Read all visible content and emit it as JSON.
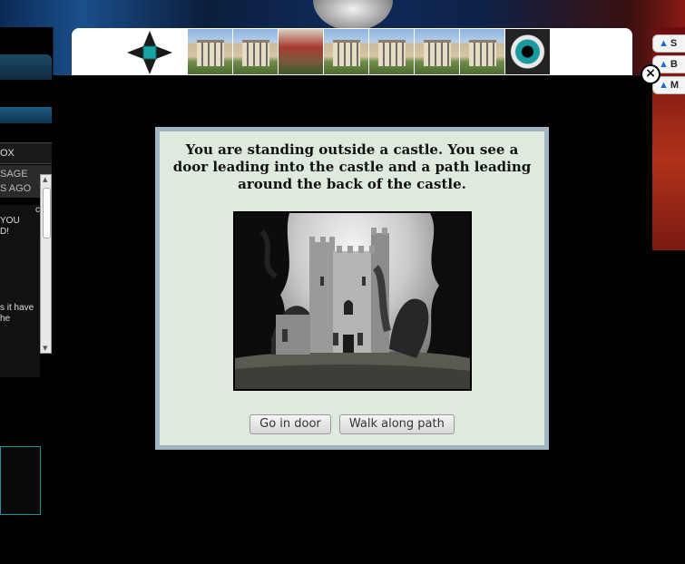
{
  "left_panel": {
    "box_title": "OX",
    "messages_header_line1": "SAGE",
    "messages_header_line2": "S AGO",
    "message_lines": [
      "c",
      "YOU",
      "D!",
      "",
      "",
      "",
      "",
      "",
      "",
      "s it have",
      "he"
    ]
  },
  "right_panel": {
    "buttons": [
      {
        "label": "S"
      },
      {
        "label": "B"
      },
      {
        "label": "M"
      }
    ]
  },
  "close_button": {
    "glyph": "×"
  },
  "dialog": {
    "text": "You are standing outside a castle. You see a door leading into the castle and a path leading around the back of the castle.",
    "buttons": [
      {
        "label": "Go in door"
      },
      {
        "label": "Walk along path"
      }
    ]
  },
  "icons": {
    "banner_logo": "compass-diamond-icon",
    "close": "close-icon",
    "right_buttons": "triangle-icon"
  },
  "colors": {
    "dialog_bg": "#dfeadf",
    "dialog_border": "#a3b4c3",
    "overlay": "#000000"
  }
}
